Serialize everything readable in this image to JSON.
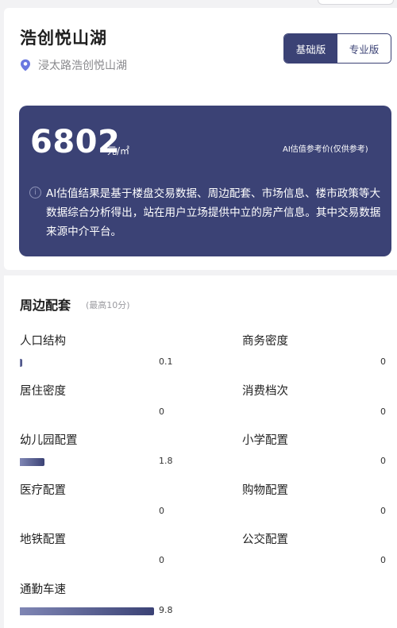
{
  "project": {
    "title": "浩创悦山湖",
    "address": "浸太路浩创悦山湖",
    "pin_icon": "location-pin-icon"
  },
  "version_toggle": {
    "basic_label": "基础版",
    "pro_label": "专业版",
    "selected": "基础版"
  },
  "valuation": {
    "price": "6802",
    "unit": "元/㎡",
    "caption": "AI估值参考价(仅供参考)",
    "note": "AI估值结果是基于楼盘交易数据、周边配套、市场信息、楼市政策等大数据综合分析得出，站在用户立场提供中立的房产信息。其中交易数据来源中介平台。",
    "info_icon": "info-icon"
  },
  "surroundings": {
    "title": "周边配套",
    "subtitle": "(最高10分)",
    "max_score": 10,
    "items": [
      {
        "label": "人口结构",
        "value": "0.1",
        "score": 0.1
      },
      {
        "label": "商务密度",
        "value": "0",
        "score": 0
      },
      {
        "label": "居住密度",
        "value": "0",
        "score": 0
      },
      {
        "label": "消费档次",
        "value": "0",
        "score": 0
      },
      {
        "label": "幼儿园配置",
        "value": "1.8",
        "score": 1.8
      },
      {
        "label": "小学配置",
        "value": "0",
        "score": 0
      },
      {
        "label": "医疗配置",
        "value": "0",
        "score": 0
      },
      {
        "label": "购物配置",
        "value": "0",
        "score": 0
      },
      {
        "label": "地铁配置",
        "value": "0",
        "score": 0
      },
      {
        "label": "公交配置",
        "value": "0",
        "score": 0
      },
      {
        "label": "通勤车速",
        "value": "9.8",
        "score": 9.8
      }
    ]
  },
  "colors": {
    "primary": "#3b4275",
    "pin": "#6b78e0"
  }
}
